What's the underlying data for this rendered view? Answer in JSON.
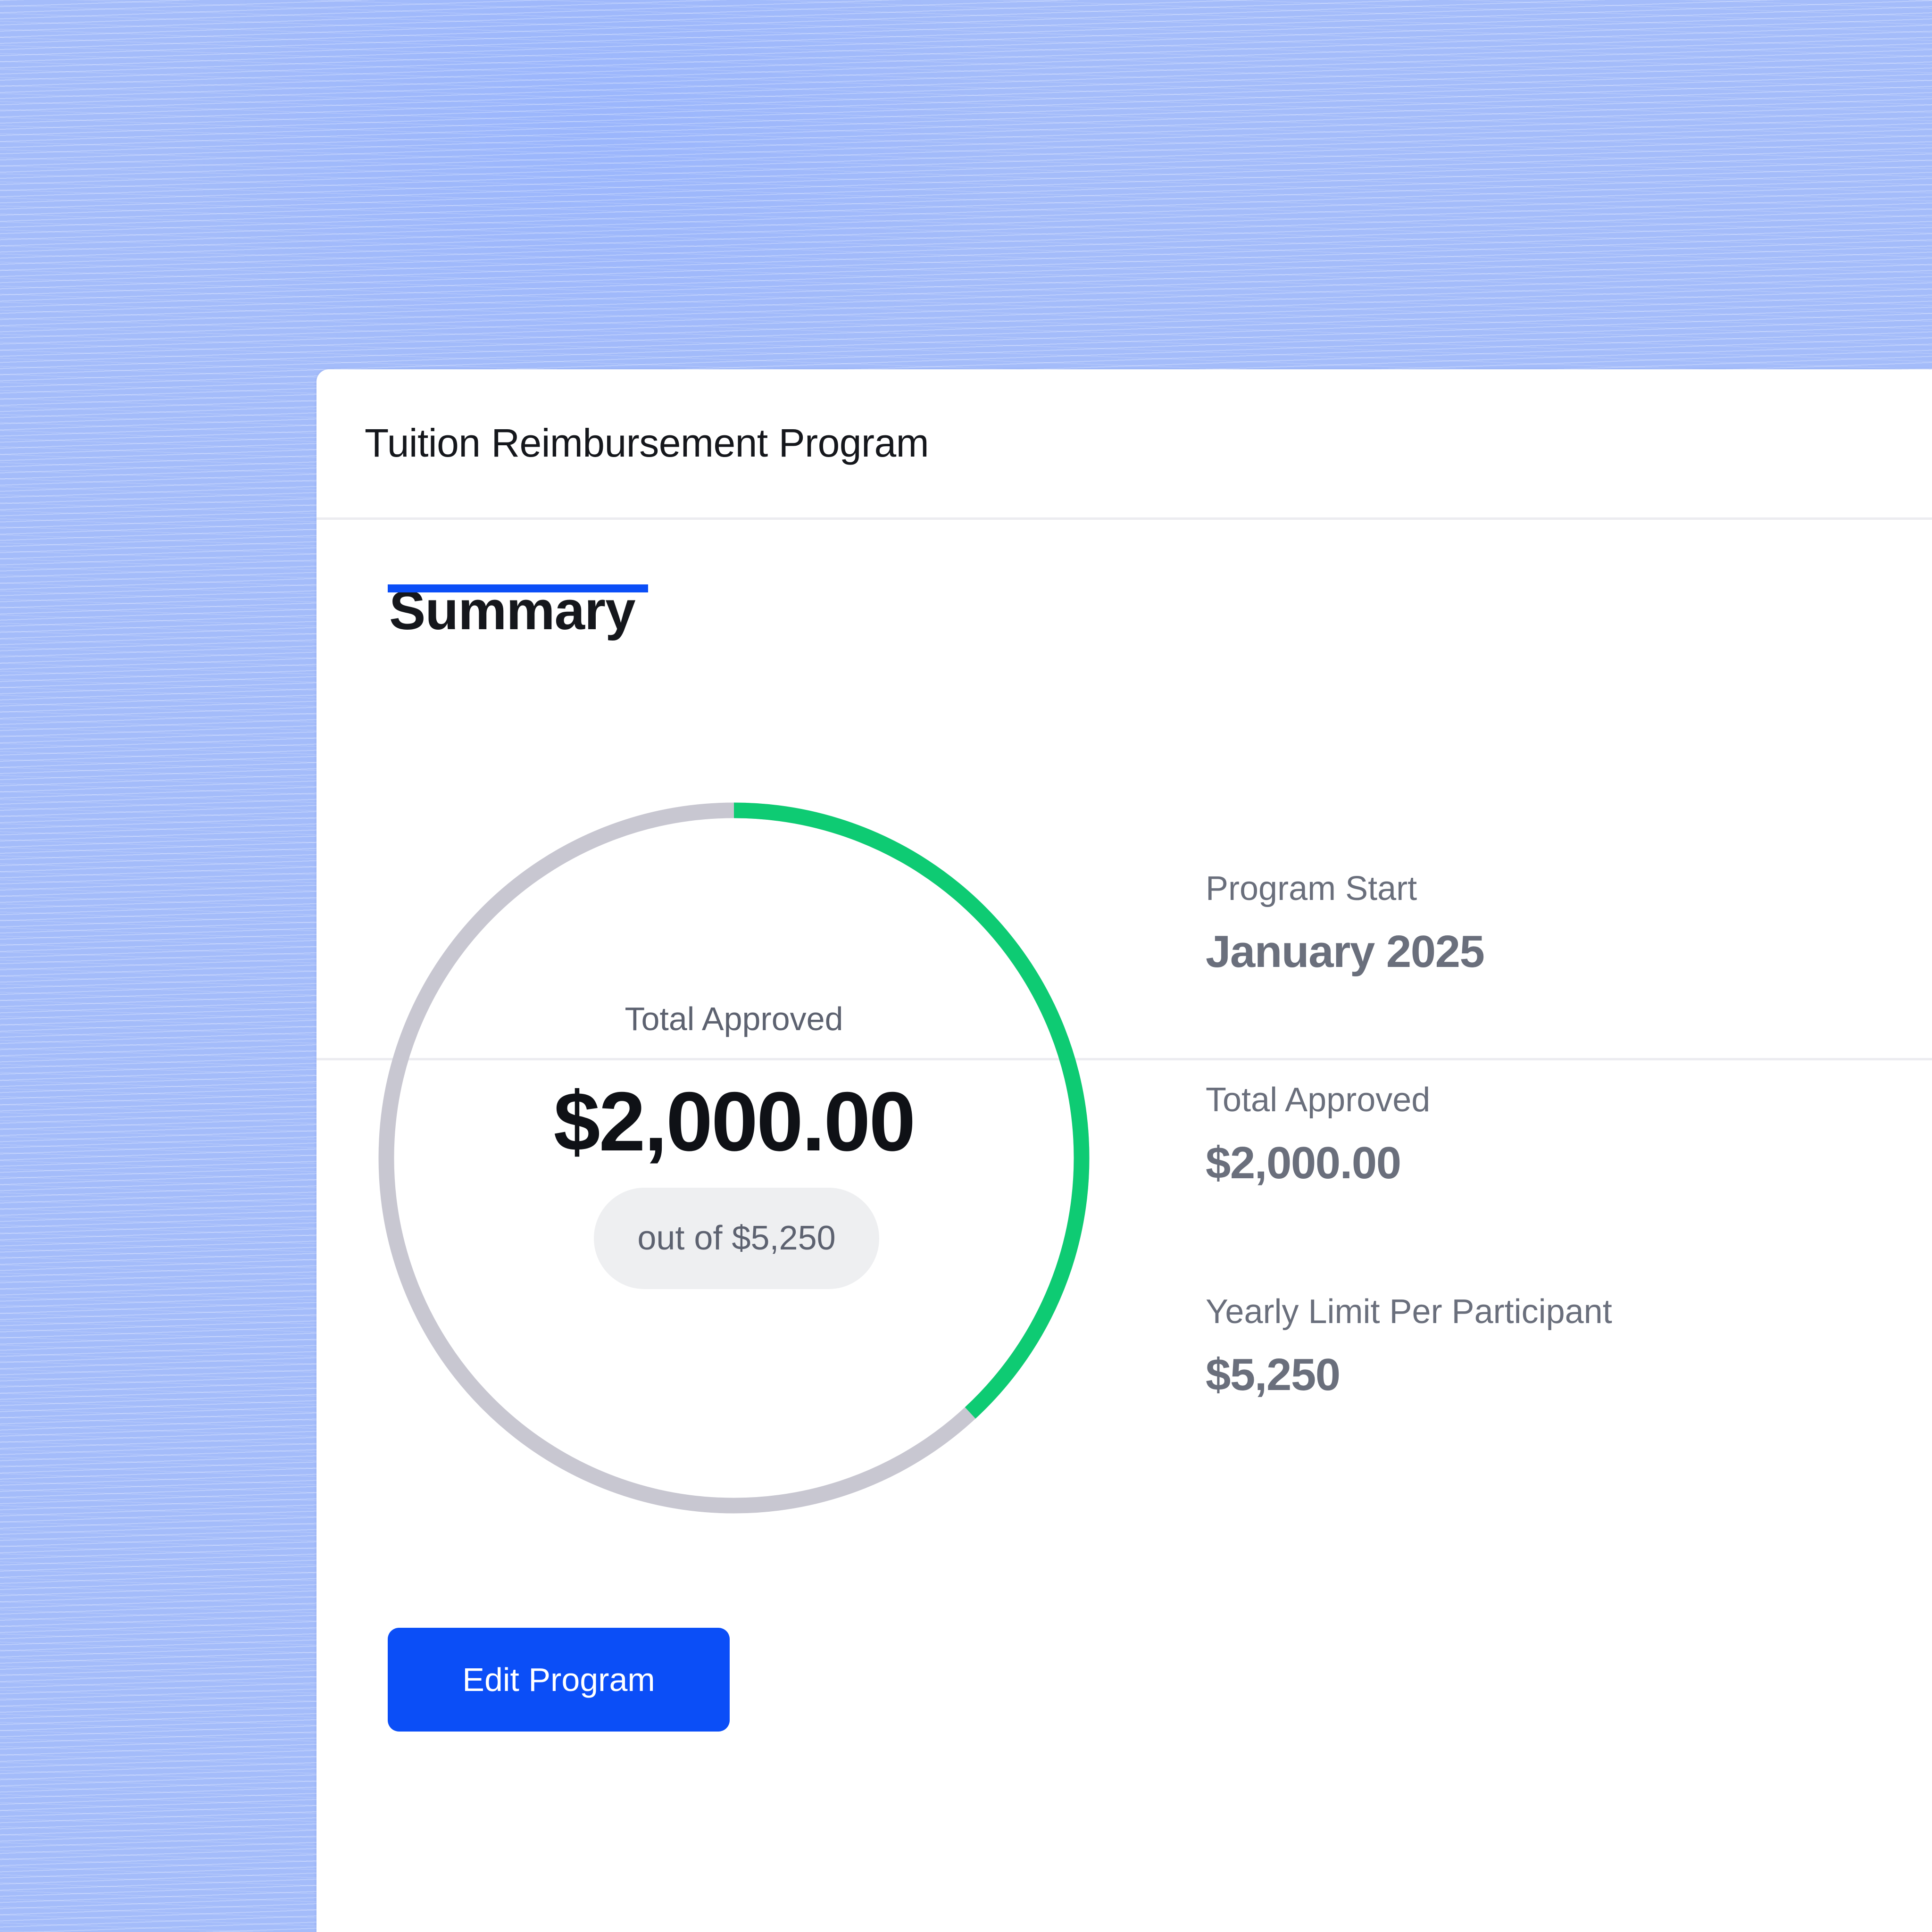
{
  "program": {
    "title": "Tuition Reimbursement Program"
  },
  "tabs": [
    {
      "label": "Summary",
      "active": true
    }
  ],
  "gauge": {
    "label": "Total Approved",
    "amount": "$2,000.00",
    "limit_text": "out of $5,250",
    "approved_value": 2000,
    "limit_value": 5250,
    "progress_fraction": 0.381,
    "progress_color": "#0ecb73",
    "track_color": "#c8c7d1"
  },
  "details": [
    {
      "label": "Program Start",
      "value": "January 2025"
    },
    {
      "label": "Total Approved",
      "value": "$2,000.00"
    },
    {
      "label": "Yearly Limit Per Participant",
      "value": "$5,250"
    }
  ],
  "actions": {
    "edit_label": "Edit Program"
  },
  "colors": {
    "accent": "#0b4ef7",
    "background": "#a9c0fb"
  }
}
